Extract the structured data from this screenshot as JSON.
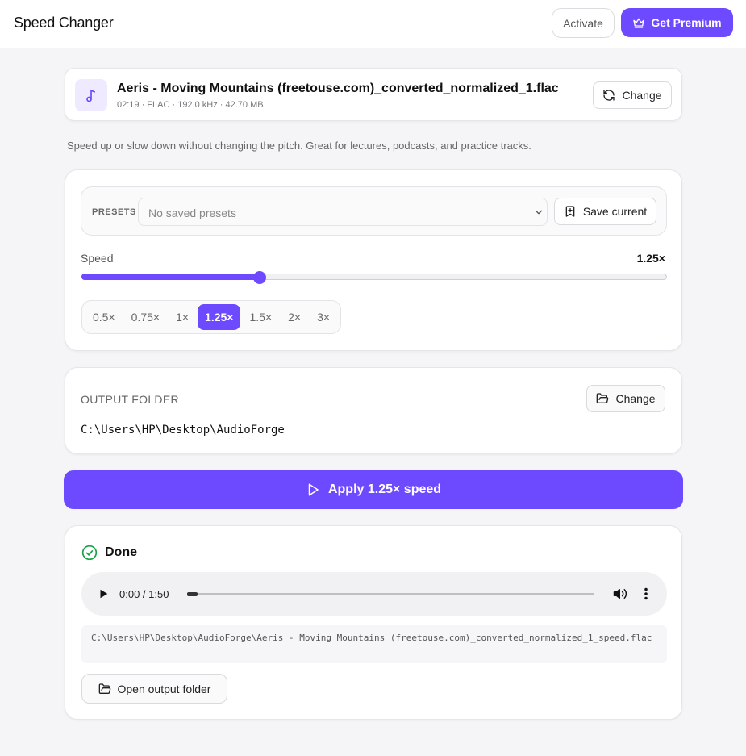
{
  "app": {
    "title": "Speed Changer"
  },
  "header": {
    "activate_label": "Activate",
    "premium_label": "Get Premium"
  },
  "file": {
    "name": "Aeris - Moving Mountains (freetouse.com)_converted_normalized_1.flac",
    "meta": "02:19 · FLAC · 192.0 kHz · 42.70 MB",
    "change_label": "Change",
    "icon": "music-note-icon"
  },
  "description": "Speed up or slow down without changing the pitch. Great for lectures, podcasts, and practice tracks.",
  "presets": {
    "label": "PRESETS",
    "selected": "No saved presets",
    "save_label": "Save current"
  },
  "speed": {
    "label": "Speed",
    "value_label": "1.25×",
    "slider_fraction": 0.304,
    "options": [
      "0.5×",
      "0.75×",
      "1×",
      "1.25×",
      "1.5×",
      "2×",
      "3×"
    ],
    "active_index": 3
  },
  "output": {
    "label": "OUTPUT FOLDER",
    "change_label": "Change",
    "path": "C:\\Users\\HP\\Desktop\\AudioForge"
  },
  "apply": {
    "label": "Apply 1.25× speed"
  },
  "result": {
    "status": "Done",
    "player_time": "0:00 / 1:50",
    "progress_fraction": 0.0,
    "path": "C:\\Users\\HP\\Desktop\\AudioForge\\Aeris - Moving Mountains (freetouse.com)_converted_normalized_1_speed.flac",
    "open_folder_label": "Open output folder"
  },
  "colors": {
    "accent": "#6d4aff",
    "success": "#16a34a",
    "background": "#f5f5f7"
  }
}
